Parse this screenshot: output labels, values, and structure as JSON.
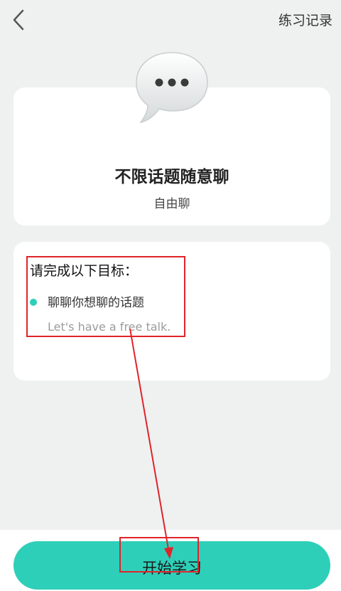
{
  "header": {
    "records_label": "练习记录"
  },
  "topic": {
    "title": "不限话题随意聊",
    "subtitle": "自由聊"
  },
  "goals": {
    "heading": "请完成以下目标：",
    "items": [
      {
        "text": "聊聊你想聊的话题",
        "translation": "Let's have a free talk."
      }
    ]
  },
  "actions": {
    "start_label": "开始学习"
  },
  "colors": {
    "accent": "#2ecfb8",
    "annotation": "#e0242a",
    "background": "#eff1f1"
  },
  "icons": {
    "back": "chevron-left-icon",
    "topic": "speech-bubble-icon",
    "bullet": "dot-icon"
  }
}
